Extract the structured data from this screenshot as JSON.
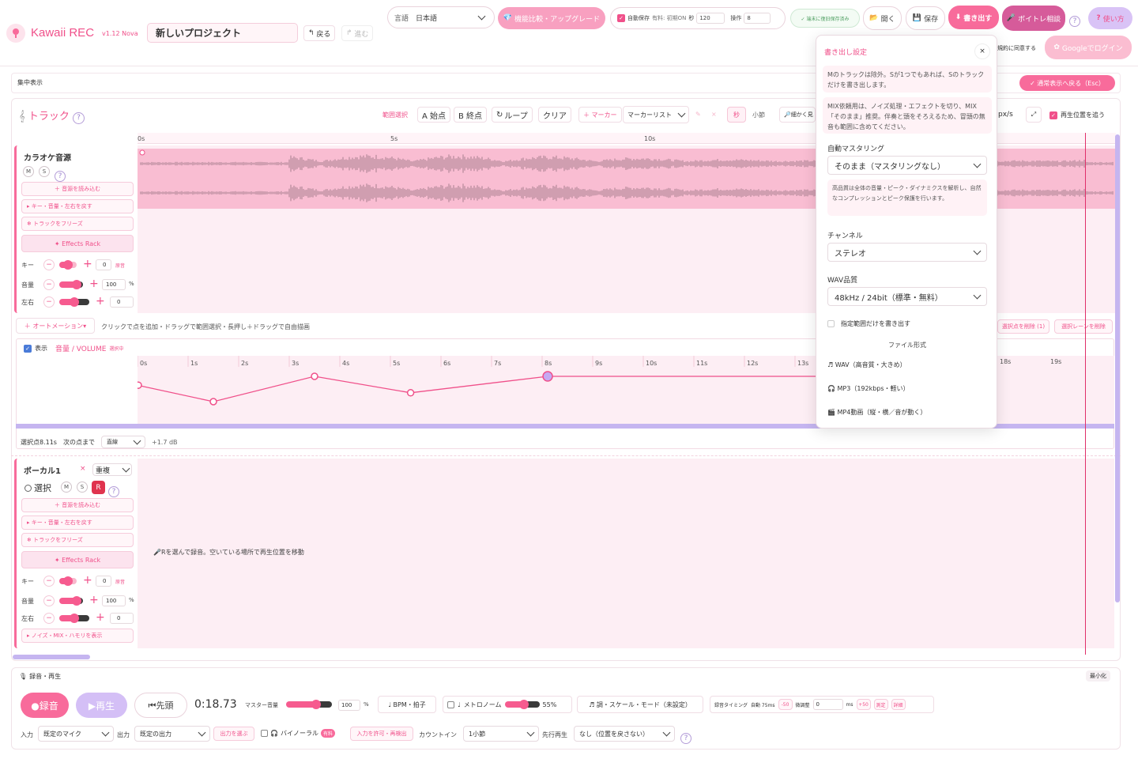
{
  "app": {
    "name": "Kawaii REC",
    "version": "v1.12 Nova",
    "project_name": "新しいプロジェクト",
    "undo": "戻る",
    "redo": "進む"
  },
  "header": {
    "lang_label": "言語",
    "lang_value": "日本語",
    "upgrade": "機能比較・アップグレード",
    "autosave_label": "自動保存",
    "autosave_hint": "有料: 初期ON",
    "sec_label": "秒",
    "sec_value": "120",
    "ops_label": "操作",
    "ops_value": "8",
    "saved_status": "✓ 端末に復旧保存済み",
    "open": "開く",
    "save": "保存",
    "export": "書き出す",
    "voice": "ボイトレ相談",
    "help": "使い方",
    "terms": "規約に同意する",
    "google_login": "Googleでログイン"
  },
  "focus": {
    "label": "集中表示",
    "back": "✓ 通常表示へ戻る（Esc）"
  },
  "tracks_toolbar": {
    "title": "トラック",
    "range": "範囲選択",
    "a_start": "A 始点",
    "b_end": "B 終点",
    "loop": "ループ",
    "clear": "クリア",
    "marker": "＋ マーカー",
    "marker_list": "マーカーリスト",
    "sec": "秒",
    "bar": "小節",
    "zoom": "細かく見",
    "pxs": "px/s",
    "follow": "再生位置を追う"
  },
  "ruler": {
    "t0": "0s",
    "t5": "5s",
    "t10": "10s"
  },
  "track1": {
    "name": "カラオケ音源",
    "m": "M",
    "s": "S",
    "load": "＋ 音源を読み込む",
    "kvp": "▸ キー・音量・左右を戻す",
    "freeze": "❄ トラックをフリーズ",
    "fx": "✦ Effects Rack",
    "key_label": "キー",
    "key_value": "0",
    "key_unit": "原音",
    "vol_label": "音量",
    "vol_value": "100",
    "vol_unit": "%",
    "pan_label": "左右",
    "pan_value": "0"
  },
  "automation": {
    "button": "＋ オートメーション▾",
    "hint": "クリックで点を追加・ドラッグで範囲選択・長押し＋ドラッグで自由描画",
    "show": "表示",
    "param": "音量 / VOLUME",
    "selecting": "選択中",
    "del_point": "選択点を削除 (1)",
    "del_lane": "選択レーンを削除",
    "ticks": [
      "0s",
      "1s",
      "2s",
      "3s",
      "4s",
      "5s",
      "6s",
      "7s",
      "8s",
      "9s",
      "10s",
      "11s",
      "12s",
      "13s",
      "",
      "",
      "17s",
      "18s",
      "19s"
    ],
    "points": [
      {
        "t": 0.0,
        "y": 0.65
      },
      {
        "t": 1.5,
        "y": 0.0
      },
      {
        "t": 3.5,
        "y": 1.0
      },
      {
        "t": 5.4,
        "y": 0.35
      },
      {
        "t": 8.11,
        "y": 1.0
      }
    ],
    "status_selected": "選択点8.11s",
    "status_next": "次の点まで",
    "curve": "直線",
    "db": "+1.7 dB"
  },
  "track2": {
    "name": "ボーカル1",
    "dup": "重複",
    "select": "選択",
    "m": "M",
    "s": "S",
    "r": "R",
    "load": "＋ 音源を読み込む",
    "kvp": "▸ キー・音量・左右を戻す",
    "freeze": "❄ トラックをフリーズ",
    "fx": "✦ Effects Rack",
    "key_label": "キー",
    "key_value": "0",
    "key_unit": "原音",
    "vol_label": "音量",
    "vol_value": "100",
    "vol_unit": "%",
    "pan_label": "左右",
    "pan_value": "0",
    "more": "▸ ノイズ・MIX・ハモリを表示",
    "hint": "🎤Rを選んで録音。空いている場所で再生位置を移動"
  },
  "transport": {
    "title": "録音・再生",
    "minimize": "最小化",
    "rec": "●録音",
    "play": "▶再生",
    "head": "⏮先頭",
    "time": "0:18.73",
    "master": "マスター音量",
    "master_value": "100",
    "master_unit": "%",
    "bpm": "♩ BPM・拍子",
    "metronome": "メトロノーム",
    "metro_value": "55%",
    "scale": "♬ 調・スケール・モード（未設定）",
    "rec_timing": "録音タイミング",
    "auto": "自動 75ms",
    "m50": "-50",
    "fine": "微調整",
    "fine_value": "0",
    "ms": "ms",
    "p50": "+50",
    "measure": "測定",
    "detail": "詳細",
    "input_label": "入力",
    "input_value": "既定のマイク",
    "output_label": "出力",
    "output_value": "既定の出力",
    "choose_out": "出力を選ぶ",
    "binaural": "バイノーラル",
    "paid": "有料",
    "allow": "入力を許可・再検出",
    "countin_label": "カウントイン",
    "countin_value": "1小節",
    "preroll_label": "先行再生",
    "preroll_value": "なし（位置を戻さない）"
  },
  "export_panel": {
    "title": "書き出し設定",
    "close": "×",
    "note1": "Mのトラックは除外。Sが1つでもあれば、Sのトラックだけを書き出します。",
    "note2": "MIX依頼用は、ノイズ処理・エフェクトを切り、MIX「そのまま」推奨。伴奏と頭をそろえるため、冒頭の無音も範囲に含めてください。",
    "mastering_label": "自動マスタリング",
    "mastering_value": "そのまま（マスタリングなし）",
    "mastering_note": "高品質は全体の音量・ピーク・ダイナミクスを解析し、自然なコンプレッションとピーク保護を行います。",
    "channel_label": "チャンネル",
    "channel_value": "ステレオ",
    "wav_label": "WAV品質",
    "wav_value": "48kHz / 24bit（標準・無料）",
    "range_only": "指定範囲だけを書き出す",
    "format_label": "ファイル形式",
    "wav": "WAV（高音質・大きめ）",
    "mp3": "MP3（192kbps・軽い）",
    "mp4": "MP4動画（縦・横／音が動く）"
  }
}
